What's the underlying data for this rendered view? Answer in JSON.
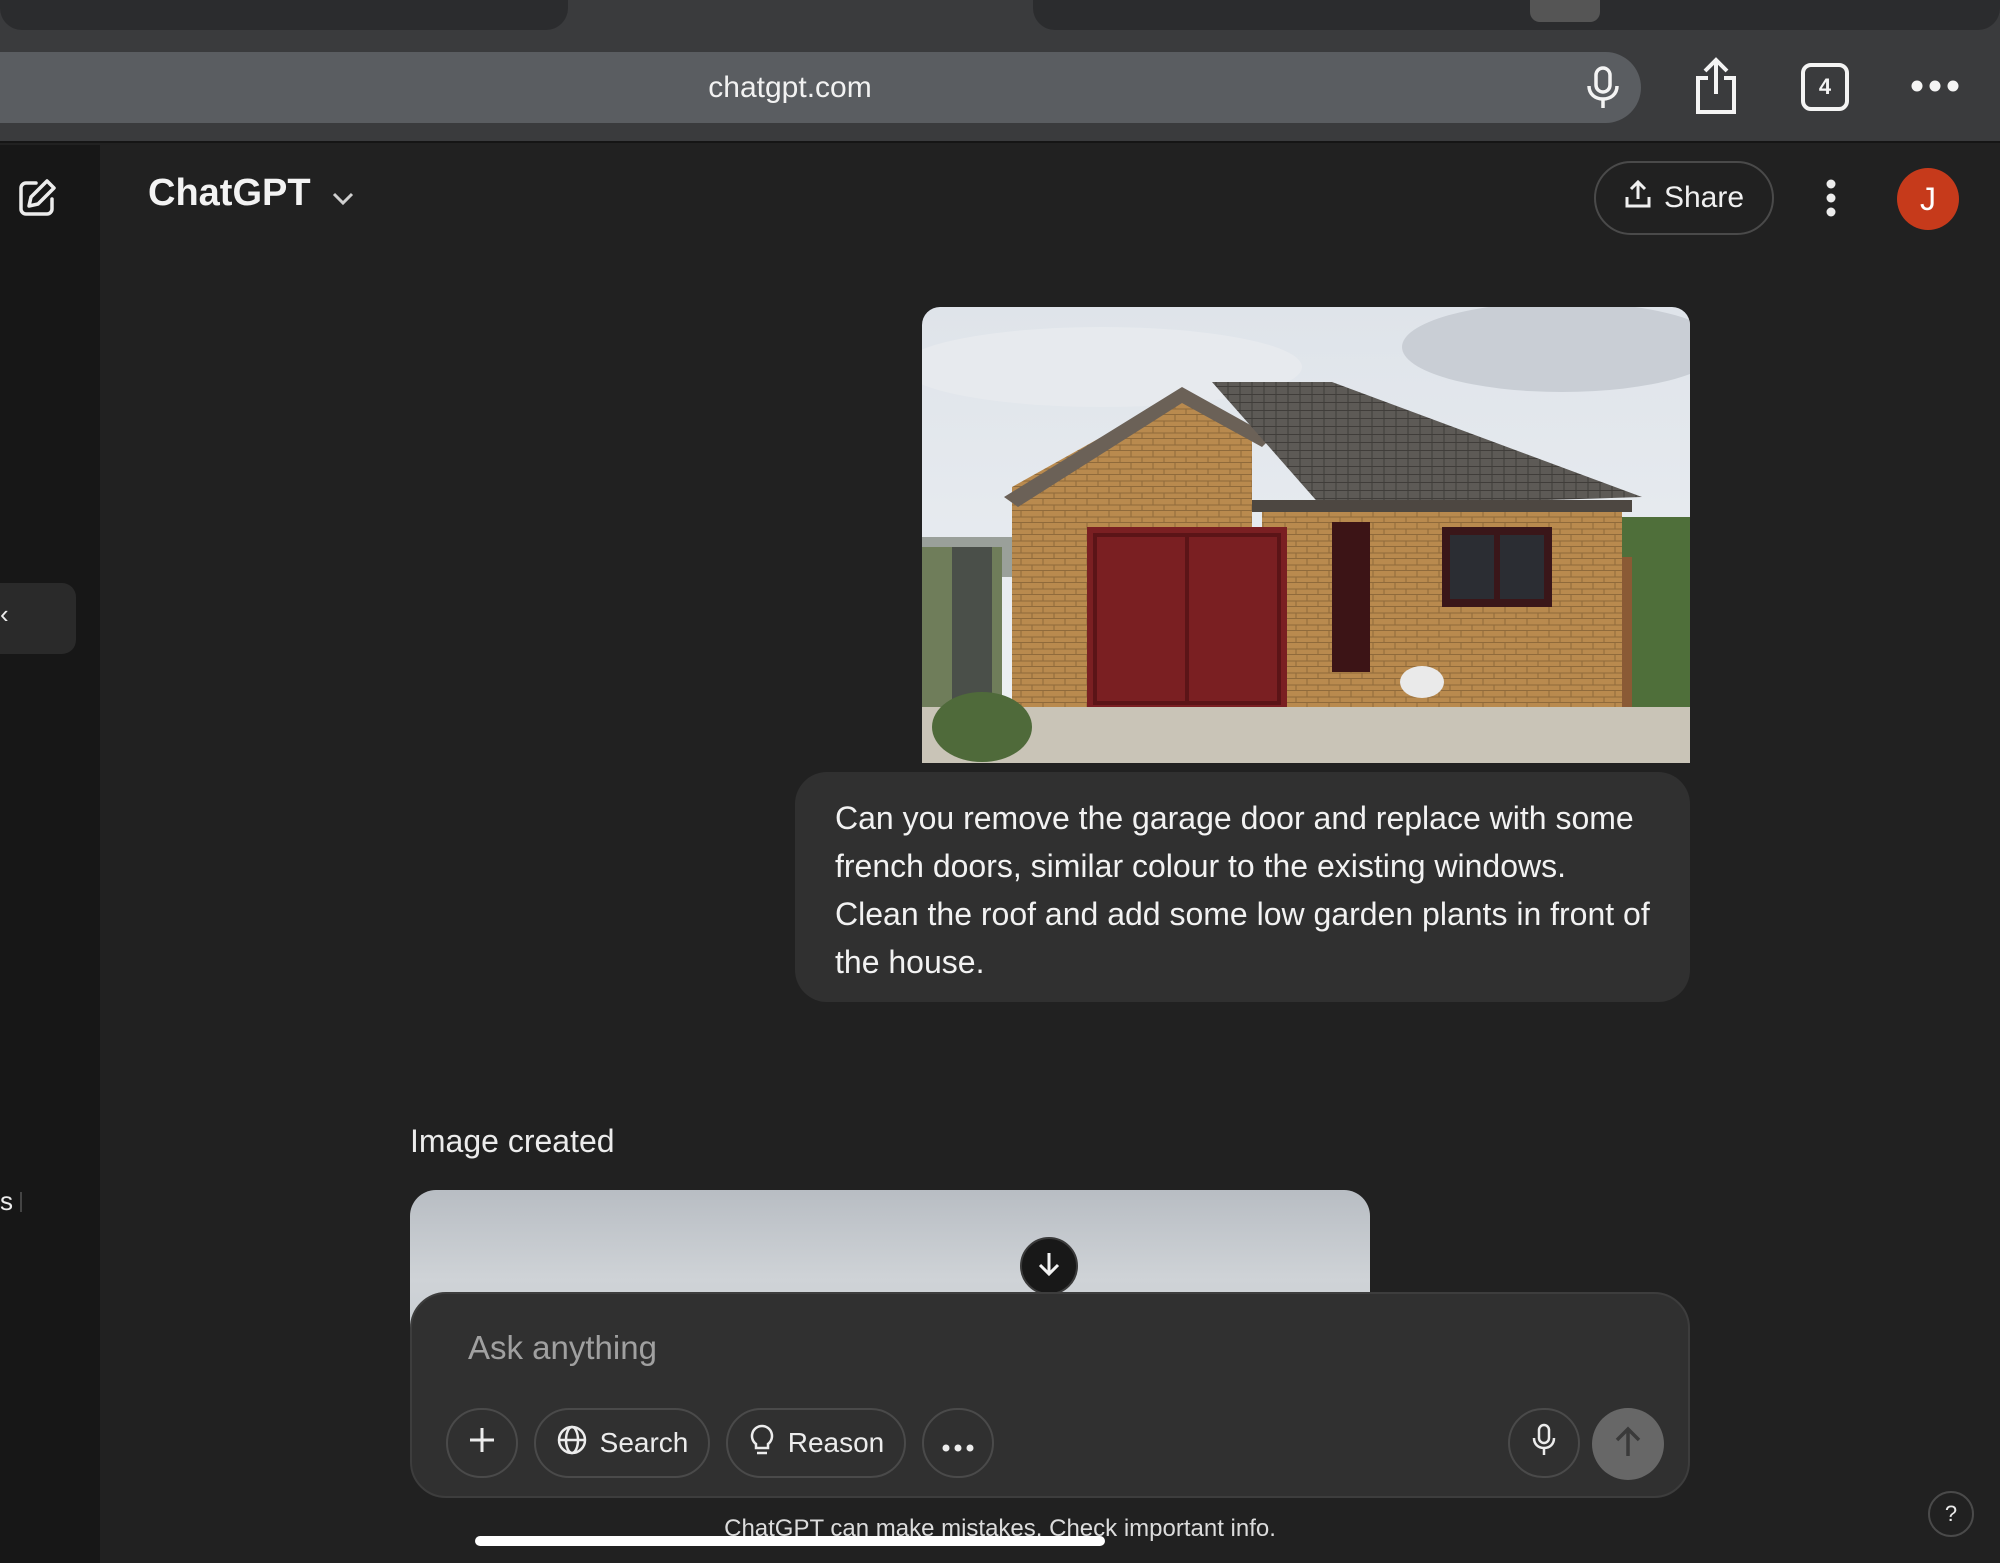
{
  "browser": {
    "url": "chatgpt.com",
    "tab_count": "4"
  },
  "header": {
    "model_name": "ChatGPT",
    "share_label": "Share",
    "avatar_initial": "J"
  },
  "sidebar": {
    "edge_fragment_1": "‹",
    "edge_fragment_2": "s"
  },
  "conversation": {
    "user_message": "Can you remove the garage door and replace with some french doors, similar colour to the existing windows. Clean the roof and add some low garden plants in front of the house.",
    "assistant_status": "Image created"
  },
  "composer": {
    "placeholder": "Ask anything",
    "search_label": "Search",
    "reason_label": "Reason"
  },
  "footer": {
    "disclaimer": "ChatGPT can make mistakes. Check important info.",
    "help_label": "?"
  },
  "icons": [
    "microphone-icon",
    "share-icon",
    "tabs-icon",
    "more-icon",
    "new-chat-icon",
    "chevron-down-icon",
    "upload-icon",
    "kebab-icon",
    "arrow-down-icon",
    "plus-icon",
    "globe-icon",
    "lightbulb-icon",
    "arrow-up-icon"
  ],
  "colors": {
    "background": "#212121",
    "sidebar": "#171717",
    "bubble": "#303030",
    "avatar": "#c63a1b",
    "garage_door": "#7a1f22"
  }
}
